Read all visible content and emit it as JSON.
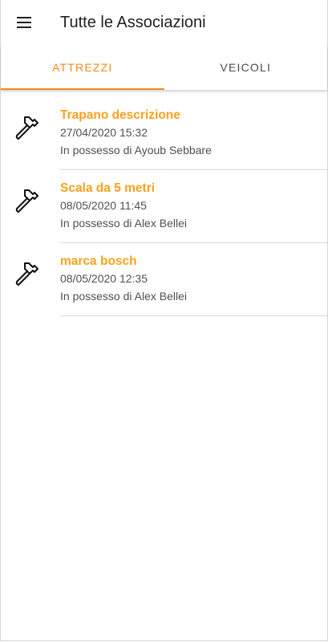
{
  "appbar": {
    "menu_icon": "hamburger-menu-icon",
    "title": "Tutte le Associazioni"
  },
  "tabs": [
    {
      "label": "ATTREZZI",
      "active": true
    },
    {
      "label": "VEICOLI",
      "active": false
    }
  ],
  "colors": {
    "accent": "#f08c1a",
    "item_title": "#f7a21b",
    "divider": "#dadada"
  },
  "items": [
    {
      "icon": "hammer-icon",
      "title": "Trapano descrizione",
      "date": "27/04/2020 15:32",
      "owner": "In possesso di Ayoub Sebbare"
    },
    {
      "icon": "hammer-icon",
      "title": "Scala da 5 metri",
      "date": "08/05/2020 11:45",
      "owner": "In possesso di Alex Bellei"
    },
    {
      "icon": "hammer-icon",
      "title": "marca bosch",
      "date": "08/05/2020 12:35",
      "owner": "In possesso di Alex Bellei"
    }
  ]
}
